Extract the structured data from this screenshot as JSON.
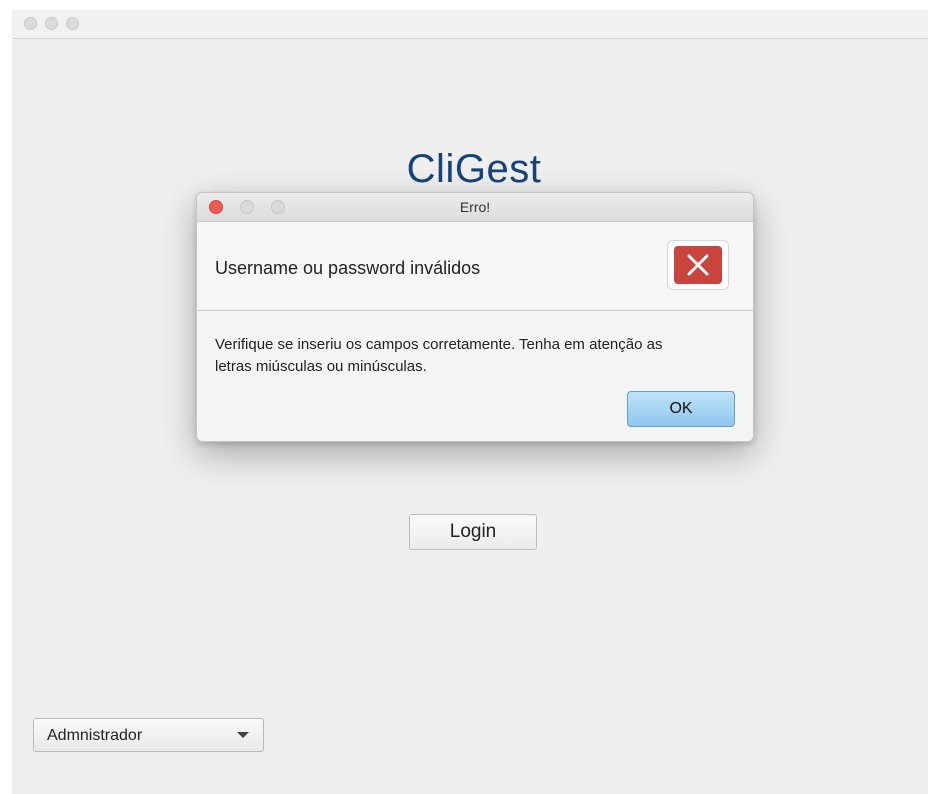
{
  "app": {
    "title": "CliGest"
  },
  "login": {
    "button_label": "Login"
  },
  "role_select": {
    "selected": "Admnistrador"
  },
  "dialog": {
    "title": "Erro!",
    "header": "Username ou password inválidos",
    "message": "Verifique se inseriu os campos corretamente. Tenha em atenção as letras miúsculas ou minúsculas.",
    "ok_label": "OK",
    "icon": "error-x-icon"
  },
  "colors": {
    "brand_title": "#16437e",
    "error_icon": "#c9443d",
    "ok_button": "#8ec7ee",
    "close_light": "#ee5a52"
  }
}
